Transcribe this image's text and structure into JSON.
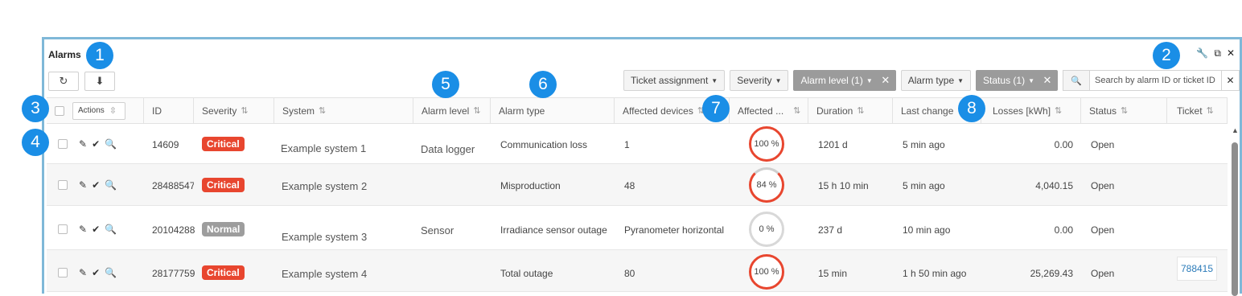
{
  "widget": {
    "title": "Alarms",
    "tools": {
      "wrench": "🔧",
      "popout": "⧉",
      "close": "✕"
    }
  },
  "toolbar": {
    "refresh": "↻",
    "export": "⬇"
  },
  "filters": [
    {
      "label": "Ticket assignment",
      "active": false
    },
    {
      "label": "Severity",
      "active": false
    },
    {
      "label": "Alarm level (1)",
      "active": true
    },
    {
      "label": "Alarm type",
      "active": false
    },
    {
      "label": "Status (1)",
      "active": true
    }
  ],
  "search": {
    "placeholder": "Search by alarm ID or ticket ID",
    "icon": "🔍",
    "clear": "✕"
  },
  "table": {
    "actions_label": "Actions",
    "sort_glyph": "⇅",
    "headers": {
      "id": "ID",
      "severity": "Severity",
      "system": "System",
      "alarm_level": "Alarm level",
      "alarm_type": "Alarm type",
      "affected_devices": "Affected devices",
      "affected_pct": "Affected ...",
      "duration": "Duration",
      "last_change": "Last change",
      "losses": "Losses [kWh]",
      "status": "Status",
      "ticket": "Ticket"
    },
    "rows": [
      {
        "id": "14609",
        "severity": "Critical",
        "system": "Example system 1",
        "alarm_level": "Data logger",
        "alarm_type": "Communication loss",
        "affected_devices": "1",
        "affected_pct": "100 %",
        "affected_value": 100,
        "duration": "1201 d",
        "last_change": "5 min ago",
        "losses": "0.00",
        "status": "Open",
        "ticket": ""
      },
      {
        "id": "28488547",
        "severity": "Critical",
        "system": "Example system 2",
        "alarm_level": "",
        "alarm_type": "Misproduction",
        "affected_devices": "48",
        "affected_pct": "84 %",
        "affected_value": 84,
        "duration": "15 h 10 min",
        "last_change": "5 min ago",
        "losses": "4,040.15",
        "status": "Open",
        "ticket": ""
      },
      {
        "id": "20104288",
        "severity": "Normal",
        "system": "Example system 3",
        "alarm_level": "Sensor",
        "alarm_type": "Irradiance sensor outage",
        "affected_devices": "Pyranometer horizontal",
        "affected_pct": "0 %",
        "affected_value": 0,
        "duration": "237 d",
        "last_change": "10 min ago",
        "losses": "0.00",
        "status": "Open",
        "ticket": ""
      },
      {
        "id": "28177759",
        "severity": "Critical",
        "system": "Example system 4",
        "alarm_level": "",
        "alarm_type": "Total outage",
        "affected_devices": "80",
        "affected_pct": "100 %",
        "affected_value": 100,
        "duration": "15 min",
        "last_change": "1 h 50 min ago",
        "losses": "25,269.43",
        "status": "Open",
        "ticket": "788415"
      }
    ]
  },
  "callouts": [
    "1",
    "2",
    "3",
    "4",
    "5",
    "6",
    "7",
    "8"
  ],
  "colors": {
    "critical": "#e8462f",
    "normal": "#9d9d9d",
    "callout": "#1a8ee6",
    "frame": "#7fb8d8",
    "link": "#2b7bb9"
  }
}
